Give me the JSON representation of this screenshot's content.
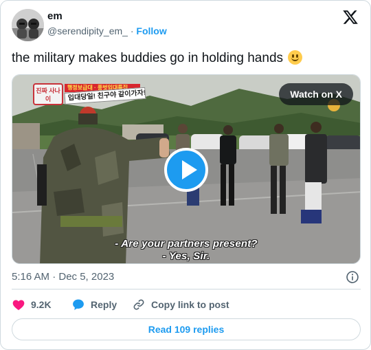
{
  "author": {
    "name": "em",
    "handle": "@serendipity_em_",
    "separator": "·",
    "follow_label": "Follow",
    "avatar_icon": "profile-photo"
  },
  "tweet": {
    "text": "the military makes buddies go in holding hands",
    "emoji": "slightly-smiling-face"
  },
  "media": {
    "watch_label": "Watch on X",
    "badge_left": "진짜 사나이",
    "badge_red": "행정보급대 · 풍벗입대특집",
    "badge_main": "입대당일! 친구야 같이가자!",
    "subtitle_line1": "- Are your partners present?",
    "subtitle_line2": "- Yes, Sir.",
    "play_icon": "play-icon"
  },
  "meta": {
    "timestamp": "5:16 AM · Dec 5, 2023"
  },
  "actions": {
    "likes": "9.2K",
    "reply_label": "Reply",
    "copy_label": "Copy link to post"
  },
  "read_replies_label": "Read 109 replies",
  "colors": {
    "accent": "#1d9bf0",
    "like": "#f91880",
    "text_secondary": "#536471",
    "border": "#cfd9de"
  }
}
